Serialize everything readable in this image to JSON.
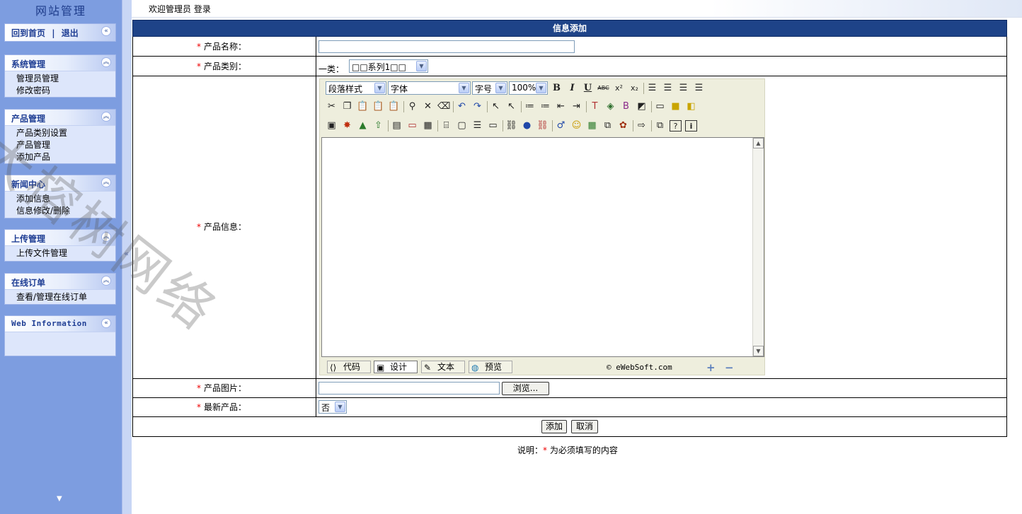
{
  "sidebar": {
    "title": "网站管理",
    "home_link": "回到首页",
    "separator": "|",
    "logout_link": "退出",
    "panels": [
      {
        "title": "系统管理",
        "items": [
          "管理员管理",
          "修改密码"
        ]
      },
      {
        "title": "产品管理",
        "items": [
          "产品类别设置",
          "产品管理",
          "添加产品"
        ]
      },
      {
        "title": "新闻中心",
        "items": [
          "添加信息",
          "信息修改/删除"
        ]
      },
      {
        "title": "上传管理",
        "items": [
          "上传文件管理"
        ]
      },
      {
        "title": "在线订单",
        "items": [
          "查看/管理在线订单"
        ]
      },
      {
        "title": "Web Information",
        "items": []
      }
    ],
    "collapse_glyph": "«",
    "expand_glyph": "»"
  },
  "topbar": {
    "welcome": "欢迎管理员 登录"
  },
  "form": {
    "header": "信息添加",
    "required_mark": "*",
    "fields": {
      "name_label": "产品名称：",
      "category_label": "产品类别：",
      "category_prefix": "一类：",
      "category_value": "□□系列1□□",
      "info_label": "产品信息：",
      "image_label": "产品图片：",
      "browse_button": "浏览...",
      "latest_label": "最新产品：",
      "latest_value": "否"
    },
    "buttons": {
      "add": "添加",
      "cancel": "取消"
    },
    "note_prefix": "说明：",
    "note_mark": "*",
    "note_text": " 为必须填写的内容"
  },
  "editor": {
    "paragraph_style": "段落样式",
    "font": "字体",
    "font_size": "字号",
    "zoom": "100%",
    "tabs": {
      "code": "代码",
      "design": "设计",
      "text": "文本",
      "preview": "预览"
    },
    "copyright": "© eWebSoft.com"
  },
  "watermark": "大榕树网络"
}
